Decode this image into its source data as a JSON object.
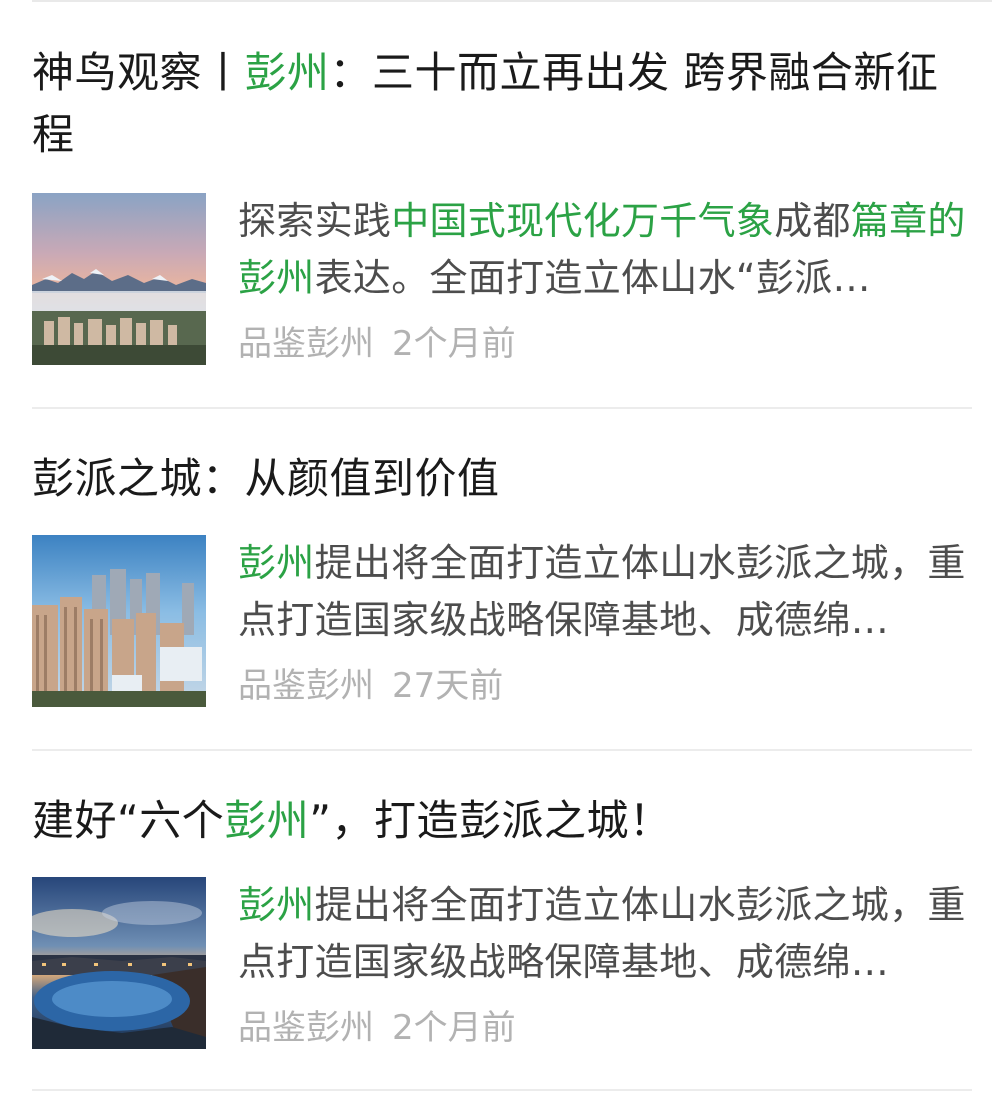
{
  "articles": [
    {
      "title_parts": [
        "神鸟观察丨",
        "彭州",
        "：三十而立再出发 跨界融合新征程"
      ],
      "excerpt_parts": [
        "探索实践",
        "中国式现代化万千气象",
        "成都",
        "篇章的彭州",
        "表达。全面打造立体山水“彭派…"
      ],
      "source": "品鉴彭州",
      "time": "2个月前",
      "thumbnail": "mountain-sunrise-city-skyline"
    },
    {
      "title_parts": [
        "彭派之城：从颜值到价值"
      ],
      "excerpt_parts": [
        "彭州",
        "提出将全面打造立体山水彭派之城，重点打造国家级战略保障基地、成德绵…"
      ],
      "source": "品鉴彭州",
      "time": "27天前",
      "thumbnail": "city-high-rise-aerial"
    },
    {
      "title_parts": [
        "建好“六个",
        "彭州",
        "”，打造彭派之城！"
      ],
      "excerpt_parts": [
        "彭州",
        "提出将全面打造立体山水彭派之城，重点打造国家级战略保障基地、成德绵…"
      ],
      "source": "品鉴彭州",
      "time": "2个月前",
      "thumbnail": "waterfront-dusk-resort"
    }
  ],
  "colors": {
    "highlight": "#2ba245",
    "title": "#1a1a1a",
    "excerpt": "#4d4d4d",
    "meta": "#b2b2b2"
  }
}
